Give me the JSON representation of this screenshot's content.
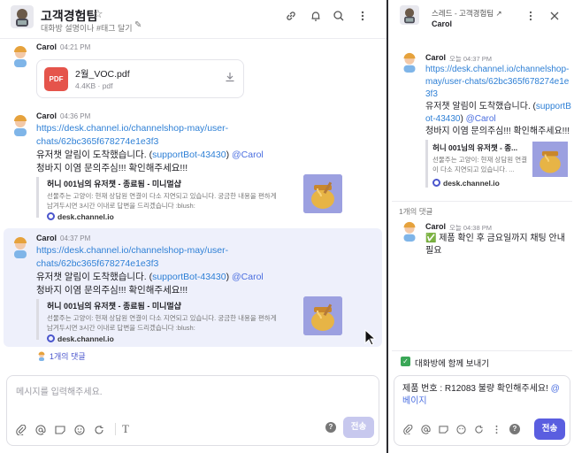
{
  "left": {
    "header": {
      "title": "고객경험팀",
      "star": "☆",
      "description": "대화방 설명이나 #태그 달기",
      "edit_icon": "✎"
    },
    "messages": [
      {
        "name": "Carol",
        "time": "04:21 PM",
        "file": {
          "name": "2월_VOC.pdf",
          "meta": "4.4KB · pdf",
          "badge": "PDF"
        }
      },
      {
        "name": "Carol",
        "time": "04:36 PM",
        "link": "https://desk.channel.io/channelshop-may/user-chats/62bc365f678274e1e3f3",
        "text1": "유저챗 알림이 도착했습니다. (",
        "bot": "supportBot-43430",
        "text1b": ") ",
        "mention": "@Carol",
        "text2": "청바지 이염 문의주심!!! 확인해주세요!!!",
        "preview": {
          "title": "허니 001님의 유저챗 - 종료됨 - 미니멀샵",
          "desc": "선물주는 고양이: 현재 상담원 연결이 다소 지연되고 있습니다. 궁금한 내용을 편하게 남겨두시면 3시간 이내로 답변을 드리겠습니다 :blush:",
          "site": "desk.channel.io"
        }
      },
      {
        "name": "Carol",
        "time": "04:37 PM",
        "link": "https://desk.channel.io/channelshop-may/user-chats/62bc365f678274e1e3f3",
        "text1": "유저챗 알림이 도착했습니다. (",
        "bot": "supportBot-43430",
        "text1b": ") ",
        "mention": "@Carol",
        "text2": "청바지 이염 문의주심!!! 확인해주세요!!!",
        "preview": {
          "title": "허니 001님의 유저챗 - 종료됨 - 미니멀샵",
          "desc": "선물주는 고양이: 현재 상담원 연결이 다소 지연되고 있습니다. 궁금한 내용을 편하게 남겨두시면 3시간 이내로 답변을 드리겠습니다 :blush:",
          "site": "desk.channel.io"
        },
        "replies": "1개의 댓글"
      }
    ],
    "composer": {
      "placeholder": "메시지를 입력해주세요.",
      "send": "전송"
    }
  },
  "right": {
    "header": {
      "crumb": "스레드 - 고객경험팀 ↗",
      "sub": "Carol"
    },
    "parent": {
      "name": "Carol",
      "time": "오늘 04:37 PM",
      "link": "https://desk.channel.io/channelshop-may/user-chats/62bc365f678274e1e3f3",
      "text1": "유저챗 알림이 도착했습니다. (",
      "bot": "supportBot-43430",
      "text1b": ") ",
      "mention": "@Carol",
      "text2": "청바지 이염 문의주심!!! 확인해주세요!!!",
      "preview": {
        "title": "허니 001님의 유저챗 - 종...",
        "desc": "선물주는 고양이: 현재 상담원 연결이 다소 지연되고 있습니다. ...",
        "site": "desk.channel.io"
      }
    },
    "reply_count": "1개의 댓글",
    "reply": {
      "name": "Carol",
      "time": "오늘 04:38 PM",
      "text": "✅ 제품 확인 후 금요일까지 채팅 안내 필요"
    },
    "also_send": "대화방에 함께 보내기",
    "composer": {
      "text": "제품 번호 : R12083 불량 확인해주세요! ",
      "mention": "@베이지",
      "send": "전송"
    }
  },
  "colors": {
    "accent": "#5a5ee0",
    "link": "#2f80d6",
    "highlight": "#eef0fb",
    "pdf": "#e5544b"
  },
  "icons": [
    "link-icon",
    "bell-icon",
    "search-icon",
    "more-icon",
    "download-icon",
    "attach-icon",
    "mention-icon",
    "tag-icon",
    "emoji-icon",
    "refresh-icon",
    "text-icon",
    "help-icon",
    "close-icon",
    "check-icon",
    "cursor-icon"
  ]
}
